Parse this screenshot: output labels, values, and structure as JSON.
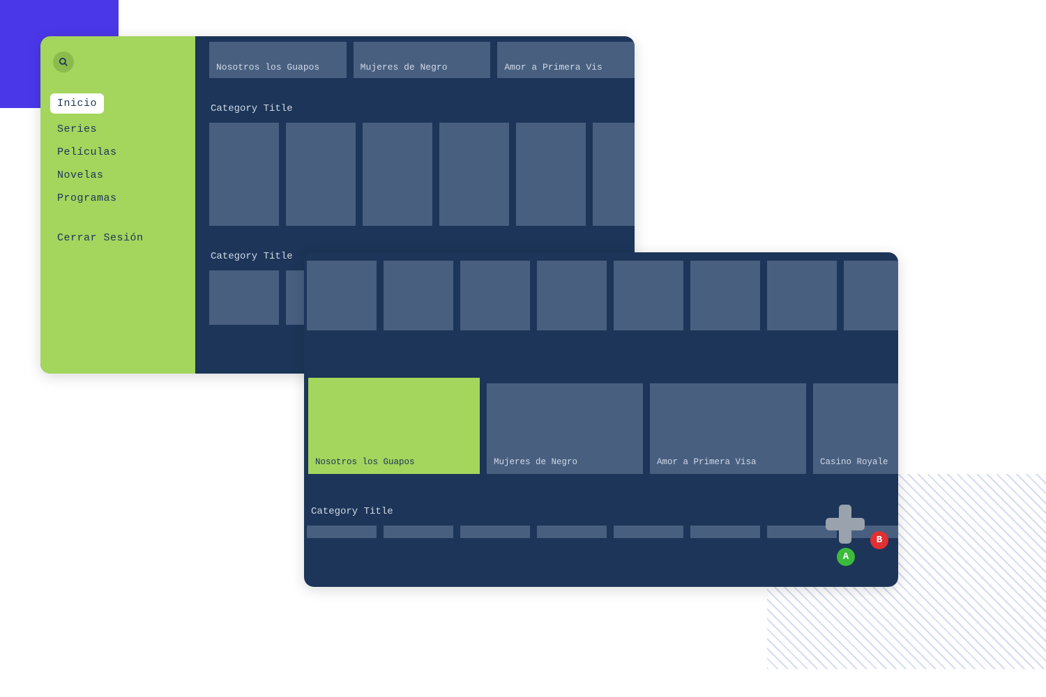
{
  "sidebar": {
    "items": [
      {
        "label": "Inicio",
        "active": true
      },
      {
        "label": "Series",
        "active": false
      },
      {
        "label": "Películas",
        "active": false
      },
      {
        "label": "Novelas",
        "active": false
      },
      {
        "label": "Programas",
        "active": false
      }
    ],
    "logout_label": "Cerrar Sesión"
  },
  "screen1": {
    "top_row": [
      "Nosotros los Guapos",
      "Mujeres de Negro",
      "Amor a Primera Vis"
    ],
    "category1_title": "Category Title",
    "category2_title": "Category Title"
  },
  "screen2": {
    "hero_row": [
      {
        "title": "Nosotros los Guapos",
        "focused": true
      },
      {
        "title": "Mujeres de Negro",
        "focused": false
      },
      {
        "title": "Amor a Primera Visa",
        "focused": false
      },
      {
        "title": "Casino Royale",
        "focused": false
      }
    ],
    "category_title": "Category Title"
  },
  "gamepad": {
    "button_a": "A",
    "button_b": "B"
  }
}
